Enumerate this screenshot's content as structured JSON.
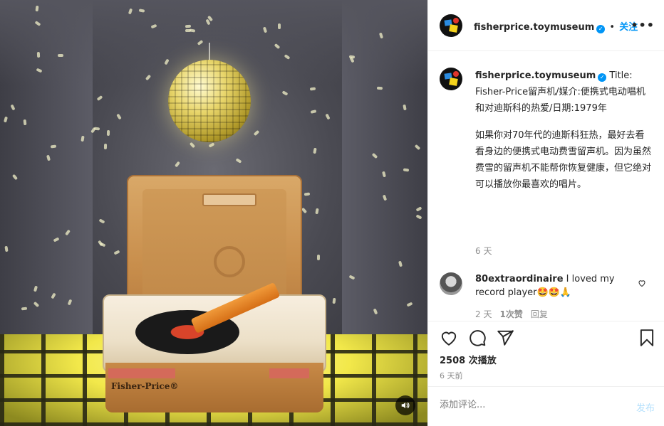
{
  "post": {
    "username": "fisherprice.toymuseum",
    "follow_label": "关注",
    "more_label": "•••",
    "verified_mark": "✓"
  },
  "caption": {
    "username": "fisherprice.toymuseum",
    "title": "Title: Fisher-Price留声机/媒介:便携式电动唱机和对迪斯科的热爱/日期:1979年",
    "body": "如果你对70年代的迪斯科狂热，最好去看看身边的便携式电动费雪留声机。因为虽然费雪的留声机不能帮你恢复健康，但它绝对可以播放你最喜欢的唱片。",
    "time": "6 天"
  },
  "comment": {
    "username": "80extraordinaire",
    "text": "I loved my record player🤩🤩🙏",
    "time": "2 天",
    "likes": "1次赞",
    "reply": "回复"
  },
  "stats": {
    "views": "2508 次播放",
    "date": "6 天前"
  },
  "add_comment": {
    "placeholder": "添加评论...",
    "post_label": "发布"
  },
  "media": {
    "brand": "Fisher-Price®"
  },
  "colors": {
    "accent": "#0095f6",
    "post_disabled": "#b2dffc"
  }
}
